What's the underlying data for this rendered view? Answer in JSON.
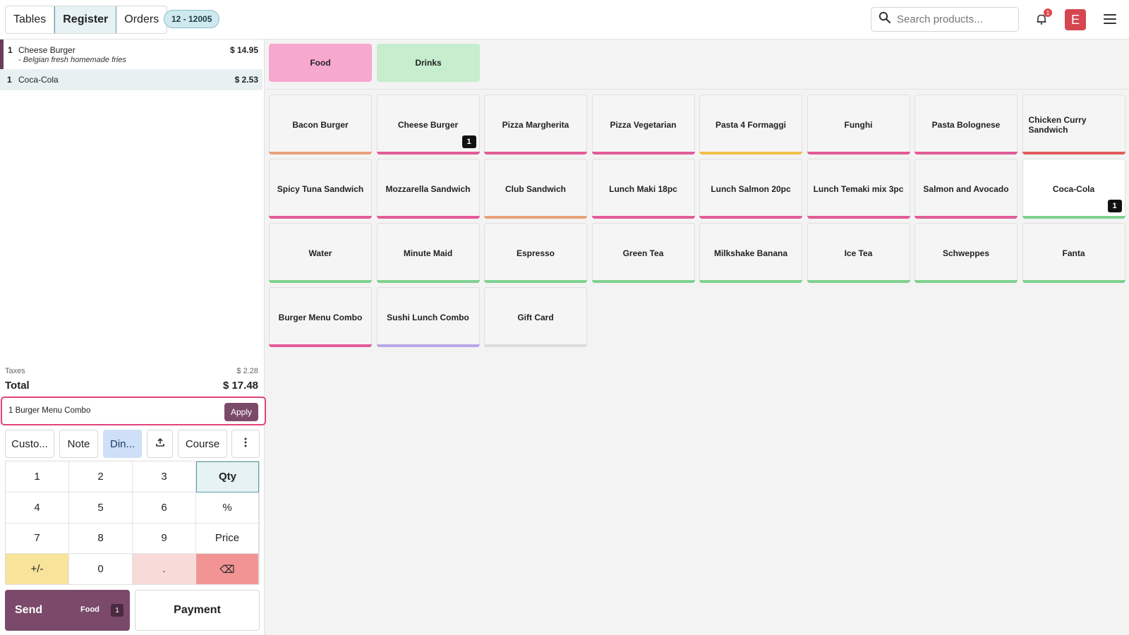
{
  "topbar": {
    "tabs": [
      {
        "label": "Tables",
        "active": false
      },
      {
        "label": "Register",
        "active": true
      },
      {
        "label": "Orders",
        "active": false
      }
    ],
    "order_ref": "12 - 12005",
    "search_placeholder": "Search products...",
    "notification_count": "1",
    "user_initial": "E",
    "icons": [
      "search-icon",
      "bell-icon",
      "menu-icon"
    ]
  },
  "order": {
    "lines": [
      {
        "qty": "1",
        "name": "Cheese Burger",
        "note": "- Belgian fresh homemade fries",
        "price": "$ 14.95"
      },
      {
        "qty": "1",
        "name": "Coca-Cola",
        "note": "",
        "price": "$ 2.53"
      }
    ],
    "taxes_label": "Taxes",
    "taxes_value": "$ 2.28",
    "total_label": "Total",
    "total_value": "$ 17.48",
    "suggestion_text": "1 Burger Menu Combo",
    "apply_label": "Apply"
  },
  "controls": {
    "customer": "Custo...",
    "note": "Note",
    "dine": "Din...",
    "course": "Course"
  },
  "numpad": {
    "keys": [
      "1",
      "2",
      "3",
      "Qty",
      "4",
      "5",
      "6",
      "%",
      "7",
      "8",
      "9",
      "Price",
      "+/-",
      "0",
      ".",
      "⌫"
    ]
  },
  "actions": {
    "send_label": "Send",
    "send_tag": "Food",
    "send_count": "1",
    "payment_label": "Payment"
  },
  "categories": [
    {
      "label": "Food",
      "color": "#f7a8cf"
    },
    {
      "label": "Drinks",
      "color": "#c6edcd"
    }
  ],
  "products": [
    {
      "name": "Bacon Burger",
      "color": "#e8a27a",
      "qty": ""
    },
    {
      "name": "Cheese Burger",
      "color": "#e25c97",
      "qty": "1"
    },
    {
      "name": "Pizza Margherita",
      "color": "#e25c97",
      "qty": ""
    },
    {
      "name": "Pizza Vegetarian",
      "color": "#e25c97",
      "qty": ""
    },
    {
      "name": "Pasta 4 Formaggi",
      "color": "#f0c14b",
      "qty": ""
    },
    {
      "name": "Funghi",
      "color": "#e25c97",
      "qty": ""
    },
    {
      "name": "Pasta Bolognese",
      "color": "#e25c97",
      "qty": ""
    },
    {
      "name": "Chicken Curry Sandwich",
      "color": "#e25a5a",
      "qty": ""
    },
    {
      "name": "Spicy Tuna Sandwich",
      "color": "#e25c97",
      "qty": ""
    },
    {
      "name": "Mozzarella Sandwich",
      "color": "#e25c97",
      "qty": ""
    },
    {
      "name": "Club Sandwich",
      "color": "#e8a27a",
      "qty": ""
    },
    {
      "name": "Lunch Maki 18pc",
      "color": "#e25c97",
      "qty": ""
    },
    {
      "name": "Lunch Salmon 20pc",
      "color": "#e25c97",
      "qty": ""
    },
    {
      "name": "Lunch Temaki mix 3pc",
      "color": "#e25c97",
      "qty": ""
    },
    {
      "name": "Salmon and Avocado",
      "color": "#e25c97",
      "qty": ""
    },
    {
      "name": "Coca-Cola",
      "color": "#7ed08e",
      "qty": "1"
    },
    {
      "name": "Water",
      "color": "#7ed08e",
      "qty": ""
    },
    {
      "name": "Minute Maid",
      "color": "#7ed08e",
      "qty": ""
    },
    {
      "name": "Espresso",
      "color": "#7ed08e",
      "qty": ""
    },
    {
      "name": "Green Tea",
      "color": "#7ed08e",
      "qty": ""
    },
    {
      "name": "Milkshake Banana",
      "color": "#7ed08e",
      "qty": ""
    },
    {
      "name": "Ice Tea",
      "color": "#7ed08e",
      "qty": ""
    },
    {
      "name": "Schweppes",
      "color": "#7ed08e",
      "qty": ""
    },
    {
      "name": "Fanta",
      "color": "#7ed08e",
      "qty": ""
    },
    {
      "name": "Burger Menu Combo",
      "color": "#e25c97",
      "qty": ""
    },
    {
      "name": "Sushi Lunch Combo",
      "color": "#b9a6e8",
      "qty": ""
    },
    {
      "name": "Gift Card",
      "color": "#dcdcdc",
      "qty": ""
    }
  ]
}
